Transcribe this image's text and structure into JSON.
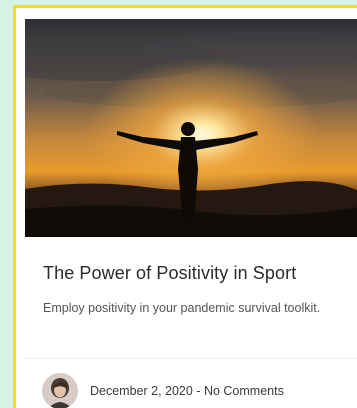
{
  "post": {
    "title": "The Power of Positivity in Sport",
    "excerpt": "Employ positivity in your pandemic survival toolkit.",
    "date": "December 2, 2020",
    "separator": " - ",
    "comments": "No Comments"
  },
  "colors": {
    "page_background": "#d6f2e4",
    "card_border": "#f5d63a",
    "title_text": "#2b2b2b"
  },
  "icons": {
    "avatar": "author-avatar"
  }
}
